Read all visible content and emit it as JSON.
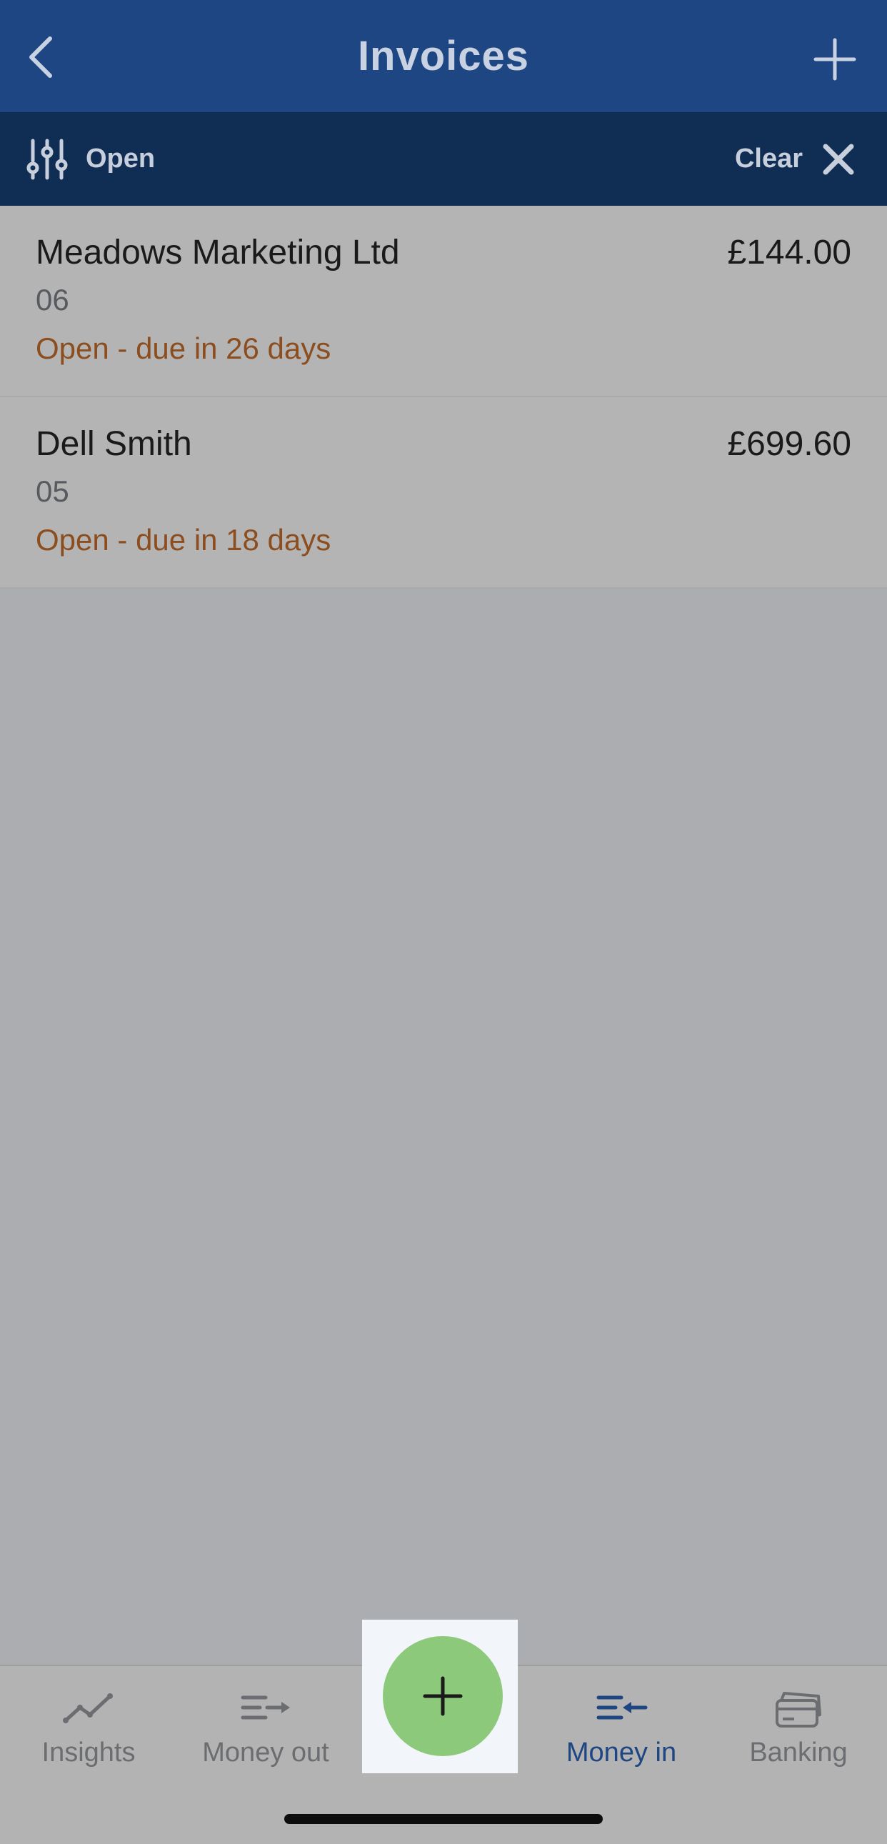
{
  "header": {
    "title": "Invoices",
    "back_icon": "chevron-left-icon",
    "add_icon": "plus-icon"
  },
  "filter": {
    "label": "Open",
    "clear_label": "Clear",
    "filter_icon": "sliders-icon",
    "clear_icon": "close-icon"
  },
  "invoices": [
    {
      "customer": "Meadows Marketing Ltd",
      "amount": "£144.00",
      "number": "06",
      "status": "Open - due in 26 days"
    },
    {
      "customer": "Dell Smith",
      "amount": "£699.60",
      "number": "05",
      "status": "Open - due in 18 days"
    }
  ],
  "tabs": [
    {
      "label": "Insights",
      "icon": "insights-icon",
      "active": false
    },
    {
      "label": "Money out",
      "icon": "money-out-icon",
      "active": false
    },
    {
      "label": "Money in",
      "icon": "money-in-icon",
      "active": true
    },
    {
      "label": "Banking",
      "icon": "banking-icon",
      "active": false
    }
  ],
  "fab": {
    "icon": "plus-icon"
  },
  "colors": {
    "header": "#1e4683",
    "filter_bar": "#102d53",
    "status_open": "#8c4d1f",
    "fab": "#8cc97b",
    "active_tab": "#1e4683"
  }
}
